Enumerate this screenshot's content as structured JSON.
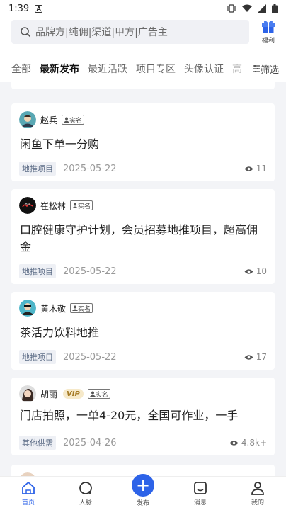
{
  "status": {
    "time": "1:39",
    "a_label": "A"
  },
  "search": {
    "placeholder": "品牌方|纯佣|渠道|甲方|广告主"
  },
  "gift": {
    "label": "福利"
  },
  "tabs": [
    {
      "label": "全部"
    },
    {
      "label": "最新发布"
    },
    {
      "label": "最近活跃"
    },
    {
      "label": "项目专区"
    },
    {
      "label": "头像认证"
    },
    {
      "label": "高"
    }
  ],
  "filter": {
    "label": "筛选"
  },
  "posts": [
    {
      "author": "赵兵",
      "badge": "实名",
      "title": "闲鱼下单一分购",
      "category": "地推项目",
      "date": "2025-05-22",
      "views": "11"
    },
    {
      "author": "崔松林",
      "badge": "实名",
      "title": "口腔健康守护计划，会员招募地推项目，超高佣金",
      "category": "地推项目",
      "date": "2025-05-22",
      "views": "10"
    },
    {
      "author": "黄木敬",
      "badge": "实名",
      "title": "茶活力饮料地推",
      "category": "地推项目",
      "date": "2025-05-22",
      "views": "17"
    },
    {
      "author": "胡丽",
      "vip": "VIP",
      "badge": "实名",
      "title": "门店拍照，一单4-20元，全国可作业，一手",
      "category": "其他供需",
      "date": "2025-04-26",
      "views": "4.8k+"
    }
  ],
  "nav": [
    {
      "label": "首页"
    },
    {
      "label": "人脉"
    },
    {
      "label": "发布"
    },
    {
      "label": "消息"
    },
    {
      "label": "我的"
    }
  ],
  "colors": {
    "accent": "#2d63e8"
  }
}
